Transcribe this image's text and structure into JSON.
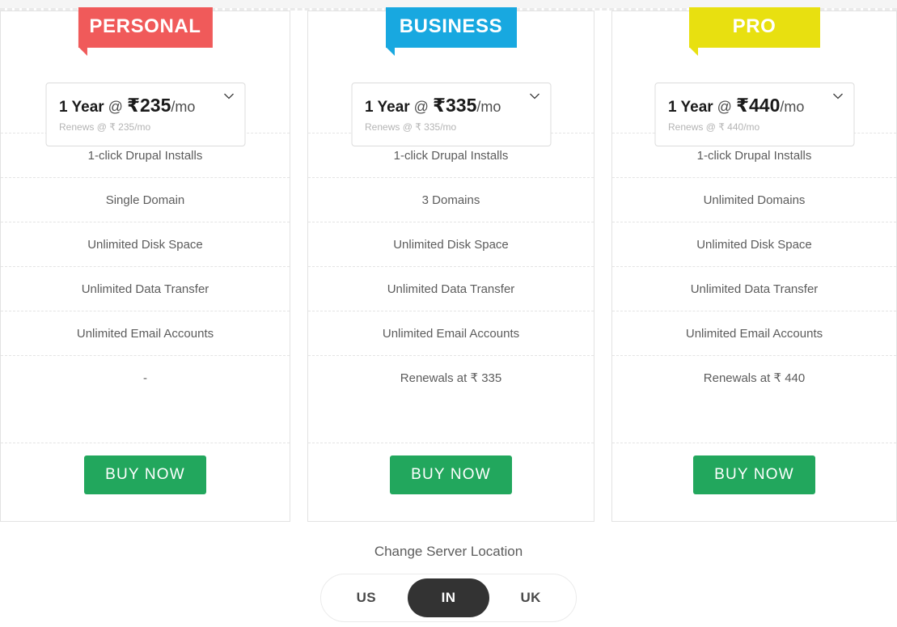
{
  "plans": [
    {
      "name": "PERSONAL",
      "accent": "#f05a5a",
      "term_prefix": "1 Year",
      "term_at": "@",
      "term_currency": "₹",
      "term_price": "235",
      "term_suffix": "/mo",
      "renew_note": "Renews @ ₹ 235/mo",
      "features": [
        "1-click Drupal Installs",
        "Single Domain",
        "Unlimited Disk Space",
        "Unlimited Data Transfer",
        "Unlimited Email Accounts",
        "-"
      ],
      "buy_label": "BUY NOW"
    },
    {
      "name": "BUSINESS",
      "accent": "#18a8e0",
      "term_prefix": "1 Year",
      "term_at": "@",
      "term_currency": "₹",
      "term_price": "335",
      "term_suffix": "/mo",
      "renew_note": "Renews @ ₹ 335/mo",
      "features": [
        "1-click Drupal Installs",
        "3 Domains",
        "Unlimited Disk Space",
        "Unlimited Data Transfer",
        "Unlimited Email Accounts",
        "Renewals at ₹ 335"
      ],
      "buy_label": "BUY NOW"
    },
    {
      "name": "PRO",
      "accent": "#e8e010",
      "term_prefix": "1 Year",
      "term_at": "@",
      "term_currency": "₹",
      "term_price": "440",
      "term_suffix": "/mo",
      "renew_note": "Renews @ ₹ 440/mo",
      "features": [
        "1-click Drupal Installs",
        "Unlimited Domains",
        "Unlimited Disk Space",
        "Unlimited Data Transfer",
        "Unlimited Email Accounts",
        "Renewals at ₹ 440"
      ],
      "buy_label": "BUY NOW"
    }
  ],
  "server_location": {
    "title": "Change Server Location",
    "options": [
      "US",
      "IN",
      "UK"
    ],
    "selected": "IN"
  },
  "colors": {
    "buy_green": "#22a75d",
    "toggle_active_bg": "#333333",
    "card_border": "#e2e2e2"
  }
}
